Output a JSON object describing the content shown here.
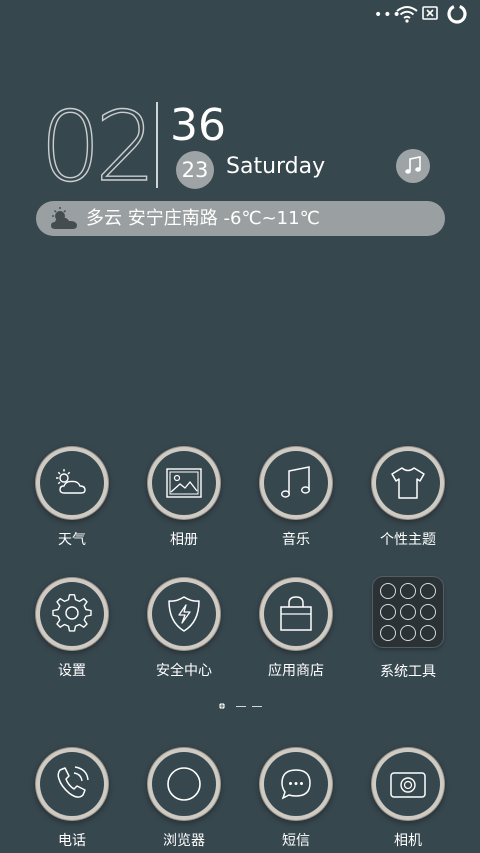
{
  "status_bar": {
    "icons": [
      "more-dots-icon",
      "wifi-icon",
      "no-sim-icon",
      "battery-ring-icon"
    ]
  },
  "clock": {
    "hours": "02",
    "minutes": "36",
    "day": "23",
    "weekday": "Saturday"
  },
  "music_button": {
    "icon": "music-note-icon"
  },
  "weather": {
    "icon": "partly-cloudy-icon",
    "text": "多云 安宁庄南路 -6℃~11℃"
  },
  "apps_row1": [
    {
      "label": "天气",
      "icon": "weather-icon"
    },
    {
      "label": "相册",
      "icon": "gallery-icon"
    },
    {
      "label": "音乐",
      "icon": "music-icon"
    },
    {
      "label": "个性主题",
      "icon": "tshirt-icon"
    }
  ],
  "apps_row2": [
    {
      "label": "设置",
      "icon": "gear-icon"
    },
    {
      "label": "安全中心",
      "icon": "shield-icon"
    },
    {
      "label": "应用商店",
      "icon": "shopping-bag-icon"
    },
    {
      "label": "系统工具",
      "icon": "folder-icon"
    }
  ],
  "page_indicator": {
    "current": 1,
    "total": 3
  },
  "dock": [
    {
      "label": "电话",
      "icon": "phone-icon"
    },
    {
      "label": "浏览器",
      "icon": "browser-icon"
    },
    {
      "label": "短信",
      "icon": "message-icon"
    },
    {
      "label": "相机",
      "icon": "camera-icon"
    }
  ]
}
